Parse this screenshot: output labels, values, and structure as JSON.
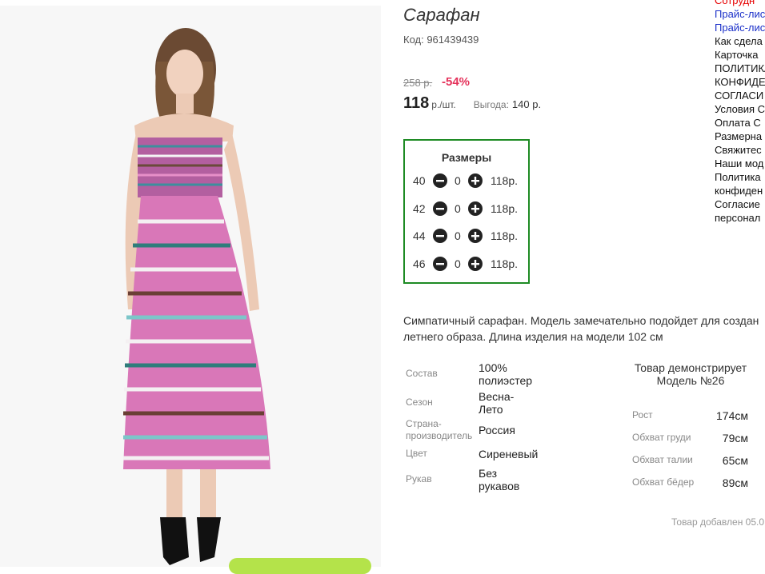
{
  "product": {
    "title": "Сарафан",
    "code": "Код: 961439439",
    "old_price": "258 р.",
    "discount": "-54%",
    "price": "118",
    "price_unit": "р./шт.",
    "saving_label": "Выгода:",
    "saving_value": "140 р."
  },
  "sizes": {
    "title": "Размеры",
    "rows": [
      {
        "size": "40",
        "qty": "0",
        "price": "118р."
      },
      {
        "size": "42",
        "qty": "0",
        "price": "118р."
      },
      {
        "size": "44",
        "qty": "0",
        "price": "118р."
      },
      {
        "size": "46",
        "qty": "0",
        "price": "118р."
      }
    ]
  },
  "description": {
    "line1": "Симпатичный сарафан. Модель замечательно подойдет для создан",
    "line2": "летнего образа. Длина изделия на модели 102 см"
  },
  "specs": [
    {
      "label": "Состав",
      "value": "100% полиэстер"
    },
    {
      "label": "Сезон",
      "value": "Весна-Лето"
    },
    {
      "label": "Страна-производитель",
      "value": "Россия"
    },
    {
      "label": "Цвет",
      "value": "Сиреневый"
    },
    {
      "label": "Рукав",
      "value": "Без рукавов"
    }
  ],
  "spec_lines": {
    "composition_1": "100%",
    "composition_2": "полиэстер",
    "season_1": "Весна-",
    "season_2": "Лето",
    "country_label_1": "Страна-",
    "country_label_2": "производитель",
    "sleeve_1": "Без",
    "sleeve_2": "рукавов"
  },
  "model": {
    "heading_1": "Товар демонстрирует",
    "heading_2": "Модель №26",
    "params": [
      {
        "label": "Рост",
        "value": "174см"
      },
      {
        "label": "Обхват груди",
        "value": "79см"
      },
      {
        "label": "Обхват талии",
        "value": "65см"
      },
      {
        "label": "Обхват бёдер",
        "value": "89см"
      }
    ]
  },
  "added_text": "Товар добавлен 05.0",
  "right_nav": [
    {
      "text": "Сотрудн",
      "color": "#e60000"
    },
    {
      "text": "Прайс-лис",
      "color": "#1a2fc9"
    },
    {
      "text": "Прайс-лис",
      "color": "#1a2fc9"
    },
    {
      "text": "Как сдела",
      "color": "#111111"
    },
    {
      "text": "Карточка",
      "color": "#111111"
    },
    {
      "text": "ПОЛИТИКА",
      "color": "#111111"
    },
    {
      "text": "КОНФИДЕ",
      "color": "#111111"
    },
    {
      "text": "СОГЛАСИ",
      "color": "#111111"
    },
    {
      "text": "Условия С",
      "color": "#111111"
    },
    {
      "text": "Оплата С",
      "color": "#111111"
    },
    {
      "text": "Размерна",
      "color": "#111111"
    },
    {
      "text": "Свяжитес",
      "color": "#111111"
    },
    {
      "text": "Наши мод",
      "color": "#111111"
    },
    {
      "text": "Политика",
      "color": "#111111"
    },
    {
      "text": "конфиден",
      "color": "#111111"
    },
    {
      "text": "Согласие",
      "color": "#111111"
    },
    {
      "text": "персонал",
      "color": "#111111"
    }
  ],
  "icons": {
    "minus": "minus-circle-icon",
    "plus": "plus-circle-icon"
  },
  "colors": {
    "accent_green": "#1e8b24",
    "discount_red": "#e5325b",
    "button_green": "#b4e34a"
  }
}
